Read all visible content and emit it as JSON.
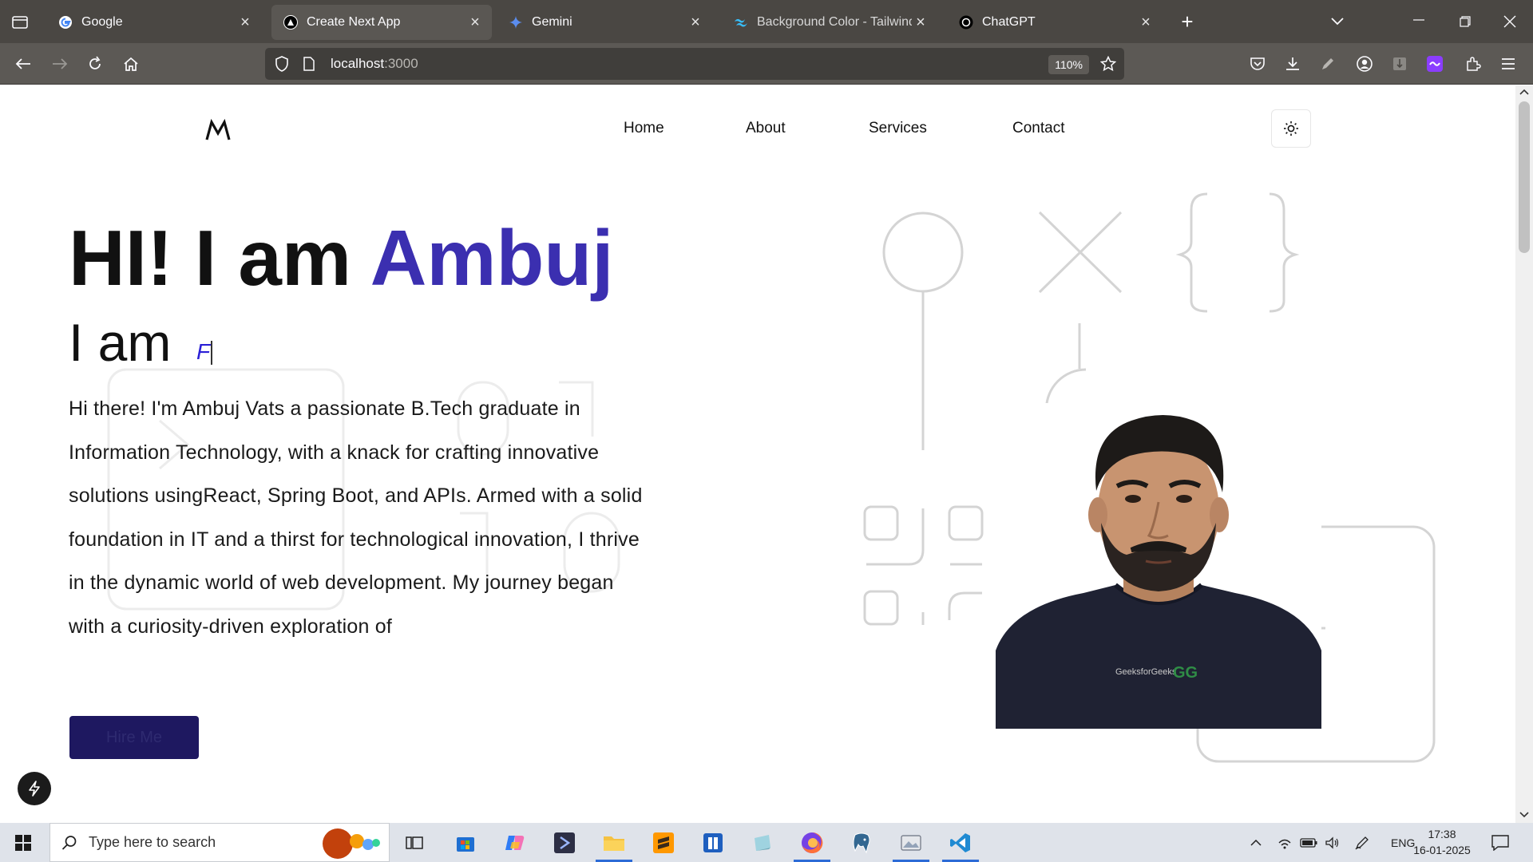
{
  "browser": {
    "tabs": [
      {
        "title": "Google",
        "icon": "google-icon",
        "active": false
      },
      {
        "title": "Create Next App",
        "icon": "nextjs-icon",
        "active": true
      },
      {
        "title": "Gemini",
        "icon": "gemini-icon",
        "active": false
      },
      {
        "title": "Background Color - Tailwind CSS",
        "icon": "tailwind-icon",
        "active": false
      },
      {
        "title": "ChatGPT",
        "icon": "chatgpt-icon",
        "active": false
      }
    ],
    "url_host": "localhost",
    "url_port": ":3000",
    "zoom": "110%"
  },
  "site": {
    "nav": [
      "Home",
      "About",
      "Services",
      "Contact"
    ],
    "hero": {
      "greeting": "HI! I am ",
      "name": "Ambuj",
      "iam": "I am",
      "typed": "F",
      "bio": "Hi there! I'm Ambuj Vats a passionate B.Tech graduate in Information Technology, with a knack for crafting innovative solutions usingReact, Spring Boot, and APIs. Armed with a solid foundation in IT and a thirst for technological innovation, I thrive in the dynamic world of web development. My journey began with a curiosity-driven exploration of",
      "hire_label": "Hire Me"
    },
    "colors": {
      "accent": "#3b2fb0",
      "button": "#1e1860"
    }
  },
  "taskbar": {
    "search_placeholder": "Type here to search",
    "language": "ENG",
    "time": "17:38",
    "date": "16-01-2025"
  }
}
